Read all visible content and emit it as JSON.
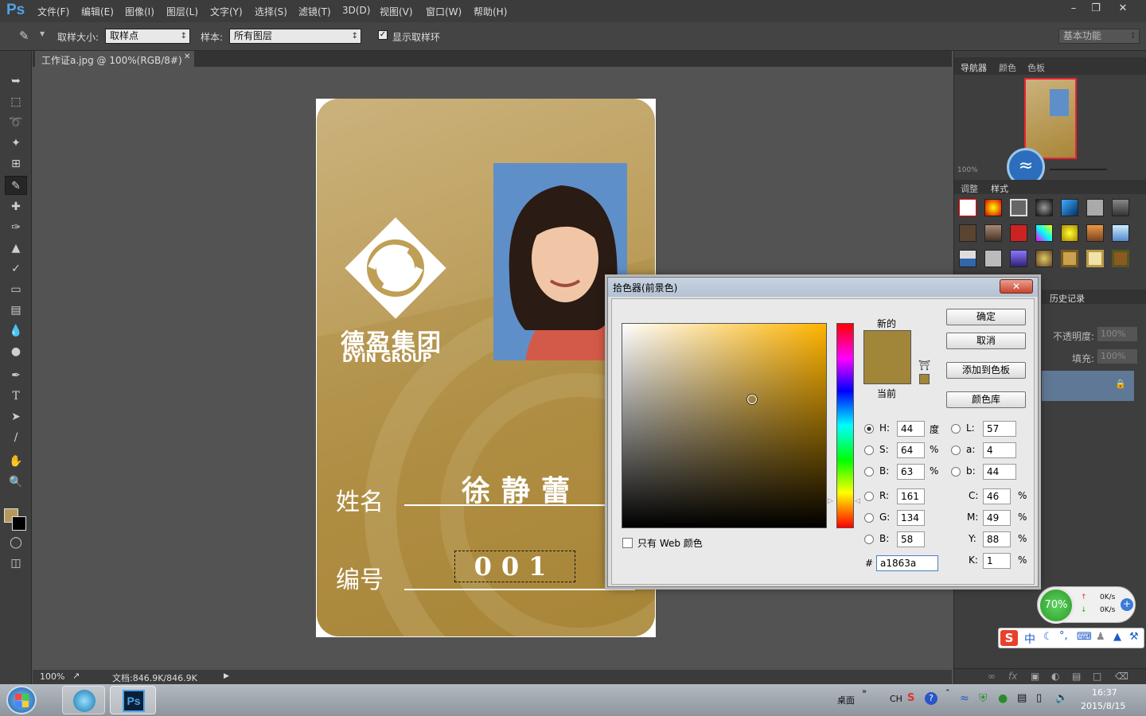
{
  "app": {
    "logo": "Ps"
  },
  "menu": [
    "文件(F)",
    "编辑(E)",
    "图像(I)",
    "图层(L)",
    "文字(Y)",
    "选择(S)",
    "滤镜(T)",
    "3D(D)",
    "视图(V)",
    "窗口(W)",
    "帮助(H)"
  ],
  "options": {
    "sample_size_label": "取样大小:",
    "sample_size_value": "取样点",
    "sample_label": "样本:",
    "sample_value": "所有图层",
    "show_ring_label": "显示取样环",
    "workspace": "基本功能"
  },
  "document": {
    "tab_title": "工作证a.jpg @ 100%(RGB/8#) *",
    "zoom": "100%",
    "doc_size": "文档:846.9K/846.9K"
  },
  "card": {
    "company_cn": "德盈集团",
    "company_en": "DYIN GROUP",
    "name_label": "姓名",
    "name_value": "徐静蕾",
    "id_label": "编号",
    "id_value": "001"
  },
  "panels": {
    "nav_tabs": [
      "导航器",
      "颜色",
      "色板"
    ],
    "nav_zoom": "100%",
    "style_tabs": [
      "调整",
      "样式"
    ],
    "history_tab": "历史记录",
    "opacity_label": "不透明度:",
    "opacity_value": "100%",
    "fill_label": "填充:",
    "fill_value": "100%"
  },
  "color_picker": {
    "title": "拾色器(前景色)",
    "close": "✕",
    "ok": "确定",
    "cancel": "取消",
    "add_to_swatches": "添加到色板",
    "color_libraries": "颜色库",
    "new_label": "新的",
    "current_label": "当前",
    "web_only": "只有 Web 颜色",
    "new_color": "#a1863a",
    "current_color": "#a1863a",
    "field_hue_color": "#ffb400",
    "fields": {
      "H": {
        "label": "H:",
        "value": "44",
        "unit": "度"
      },
      "S": {
        "label": "S:",
        "value": "64",
        "unit": "%"
      },
      "Bv": {
        "label": "B:",
        "value": "63",
        "unit": "%"
      },
      "R": {
        "label": "R:",
        "value": "161"
      },
      "G": {
        "label": "G:",
        "value": "134"
      },
      "B": {
        "label": "B:",
        "value": "58"
      },
      "L": {
        "label": "L:",
        "value": "57"
      },
      "a": {
        "label": "a:",
        "value": "4"
      },
      "b": {
        "label": "b:",
        "value": "44"
      },
      "C": {
        "label": "C:",
        "value": "46",
        "unit": "%"
      },
      "M": {
        "label": "M:",
        "value": "49",
        "unit": "%"
      },
      "Y": {
        "label": "Y:",
        "value": "88",
        "unit": "%"
      },
      "K": {
        "label": "K:",
        "value": "1",
        "unit": "%"
      }
    },
    "hex_label": "#",
    "hex_value": "a1863a"
  },
  "net_widget": {
    "percent": "70%",
    "up": "0K/s",
    "down": "0K/s"
  },
  "ime": {
    "mode": "中"
  },
  "taskbar": {
    "desktop_label": "桌面",
    "lang": "CH",
    "time": "16:37",
    "date": "2015/8/15"
  }
}
